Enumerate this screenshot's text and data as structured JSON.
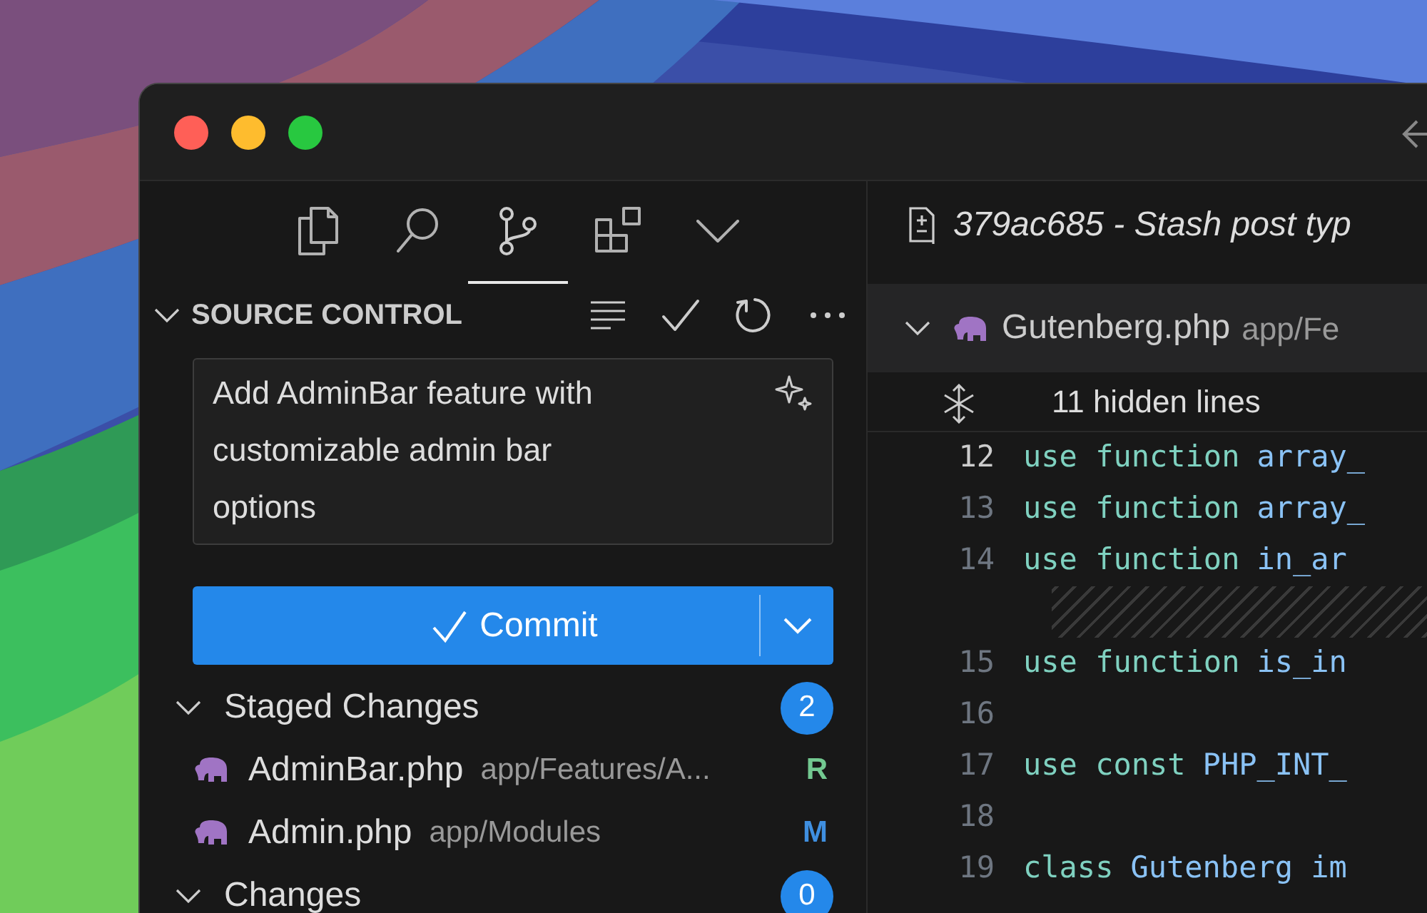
{
  "activity_tabs": [
    {
      "kind": "files",
      "selected": false
    },
    {
      "kind": "search",
      "selected": false
    },
    {
      "kind": "source-control",
      "selected": true
    },
    {
      "kind": "extensions",
      "selected": false
    },
    {
      "kind": "more",
      "selected": false
    }
  ],
  "section": {
    "title": "SOURCE CONTROL",
    "expanded": true
  },
  "commit_message": {
    "value": "Add AdminBar feature with customizable admin bar options"
  },
  "commit_button": {
    "label": "Commit"
  },
  "groups": [
    {
      "title": "Staged Changes",
      "count": "2",
      "expanded": true,
      "files": [
        {
          "name": "AdminBar.php",
          "path": "app/Features/A...",
          "status": "R",
          "color": "#73c991"
        },
        {
          "name": "Admin.php",
          "path": "app/Modules",
          "status": "M",
          "color": "#3f8fe0"
        }
      ]
    },
    {
      "title": "Changes",
      "count": "0",
      "expanded": true
    }
  ],
  "editor": {
    "title": "379ac685 - Stash post typ",
    "file": {
      "name": "Gutenberg.php",
      "path": "app/Fe",
      "expanded": true
    },
    "hidden_lines": "11 hidden lines",
    "lines": [
      {
        "kind": "code",
        "number": "12",
        "current": true,
        "tokens": [
          {
            "text": "use function",
            "kind": "keyword"
          },
          {
            "text": "array_",
            "kind": "name"
          }
        ]
      },
      {
        "kind": "code",
        "number": "13",
        "current": false,
        "tokens": [
          {
            "text": "use function",
            "kind": "keyword"
          },
          {
            "text": "array_",
            "kind": "name"
          }
        ]
      },
      {
        "kind": "code",
        "number": "14",
        "current": false,
        "tokens": [
          {
            "text": "use function",
            "kind": "keyword"
          },
          {
            "text": "in_ar",
            "kind": "name"
          }
        ]
      },
      {
        "kind": "hatch"
      },
      {
        "kind": "code",
        "number": "15",
        "current": false,
        "tokens": [
          {
            "text": "use function",
            "kind": "keyword"
          },
          {
            "text": "is_in",
            "kind": "name"
          }
        ]
      },
      {
        "kind": "code",
        "number": "16",
        "current": false
      },
      {
        "kind": "code",
        "number": "17",
        "current": false,
        "tokens": [
          {
            "text": "use const",
            "kind": "keyword"
          },
          {
            "text": "PHP_INT_",
            "kind": "name"
          }
        ]
      },
      {
        "kind": "code",
        "number": "18",
        "current": false
      },
      {
        "kind": "code",
        "number": "19",
        "current": false,
        "tokens": [
          {
            "text": "class",
            "kind": "keyword"
          },
          {
            "text": "Gutenberg im",
            "kind": "name"
          }
        ]
      }
    ]
  }
}
